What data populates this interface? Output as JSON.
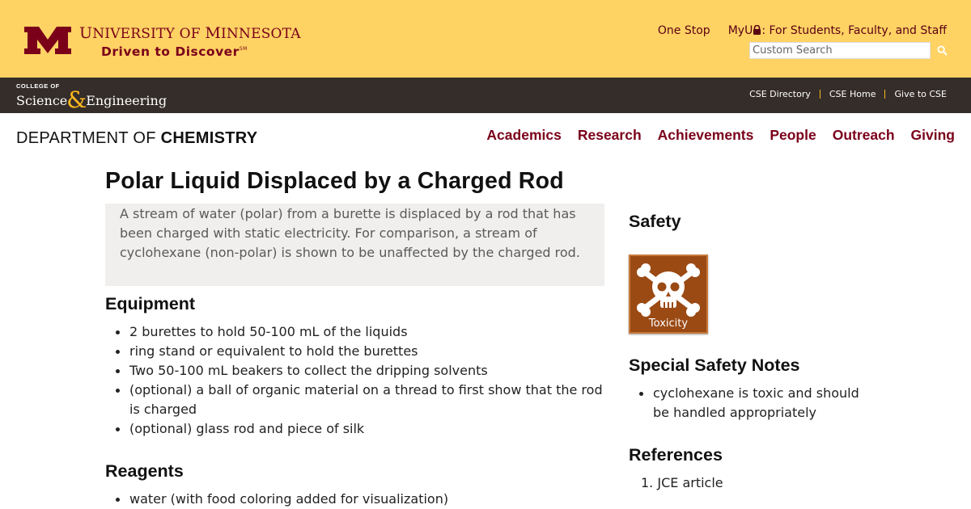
{
  "header": {
    "university_name_prefix": "U",
    "university_name_rest": "NIVERSITY OF ",
    "university_name_m": "M",
    "university_name_rest2": "INNESOTA",
    "tagline": "Driven to Discover",
    "tagline_mark": "SM",
    "links": {
      "one_stop": "One Stop",
      "myu_prefix": "MyU",
      "myu_suffix": ": For Students, Faculty, and Staff"
    },
    "search": {
      "placeholder": "Custom Search",
      "value": ""
    },
    "colors": {
      "gold": "#ffd264",
      "maroon": "#7a0019"
    }
  },
  "college_bar": {
    "logo_small": "COLLEGE OF",
    "logo_word1": "Science",
    "logo_amp": "&",
    "logo_word2": "Engineering",
    "links": [
      "CSE Directory",
      "CSE Home",
      "Give to CSE"
    ],
    "colors": {
      "bar": "#342d2a",
      "accent": "#ffb71e"
    }
  },
  "department": {
    "prefix": "DEPARTMENT OF ",
    "name": "CHEMISTRY"
  },
  "nav": [
    "Academics",
    "Research",
    "Achievements",
    "People",
    "Outreach",
    "Giving"
  ],
  "main": {
    "title": "Polar Liquid Displaced by a Charged Rod",
    "intro_lines": [
      "A stream of water (polar) from a burette is displaced by a rod that has",
      "been charged with static electricity.  For comparison, a stream of",
      "cyclohexane (non-polar) is shown to be unaffected by the charged rod."
    ],
    "equipment_heading": "Equipment",
    "equipment": [
      "2 burettes to hold 50-100 mL of the liquids",
      "ring stand or equivalent to hold the burettes",
      "Two 50-100 mL beakers to collect the dripping solvents",
      "(optional) a ball of organic material on a thread to first show that the rod is charged",
      "(optional) glass rod and piece of silk"
    ],
    "reagents_heading": "Reagents",
    "reagents": [
      "water (with food coloring added for visualization)"
    ]
  },
  "sidebar": {
    "safety_heading": "Safety",
    "hazard_icon": "skull-crossbones-icon",
    "hazard_label": "Toxicity",
    "special_notes_heading": "Special Safety Notes",
    "special_notes": [
      "cyclohexane is toxic and should be handled appropriately"
    ],
    "references_heading": "References",
    "references": [
      {
        "number": "1.",
        "text": "JCE article"
      }
    ]
  }
}
